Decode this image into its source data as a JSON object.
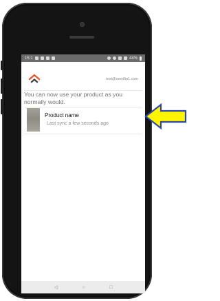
{
  "status_bar": {
    "time": "15:1",
    "battery": "44%"
  },
  "header": {
    "logo": "chevron-up-logo",
    "email": "test@seedlip1.com"
  },
  "message": "You can now use your product as you normally would.",
  "products": [
    {
      "name": "Product name",
      "sync_status": "Last sync a few seconds ago"
    }
  ],
  "nav_bar": {
    "back": "◁",
    "home": "○",
    "recents": "□"
  },
  "colors": {
    "logo_orange": "#e8582b",
    "logo_dark": "#3b3b3b",
    "status_bar": "#6b6b6b",
    "arrow_fill": "#fff500",
    "arrow_stroke": "#2f49a8"
  }
}
